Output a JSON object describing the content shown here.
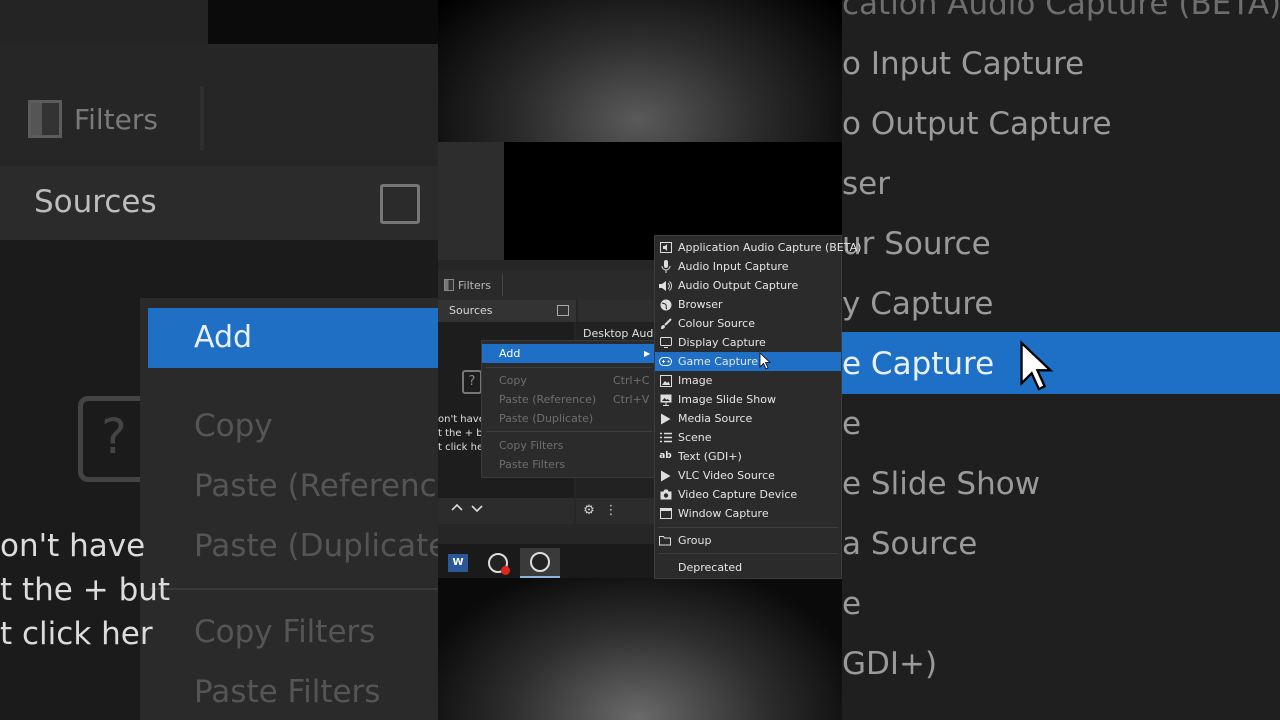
{
  "background_left": {
    "filters_label": "Filters",
    "sources_label": "Sources",
    "menu": {
      "add": "Add",
      "items": [
        "Copy",
        "Paste (Reference)",
        "Paste (Duplicate)",
        "Copy Filters",
        "Paste Filters"
      ]
    },
    "hint_lines": [
      "on't have",
      "t the + but",
      "t click her"
    ]
  },
  "background_right": {
    "items": [
      "cation Audio Capture (BETA)",
      "o Input Capture",
      "o Output Capture",
      "ser",
      "ur Source",
      "y Capture",
      "e Capture",
      "e",
      "e Slide Show",
      "a Source",
      "e",
      "GDI+)"
    ],
    "selected": "e Capture"
  },
  "obs": {
    "filters_label": "Filters",
    "sources_label": "Sources",
    "desktop_audio": "Desktop Audio",
    "hint_lines": [
      "on't have",
      "t the + but",
      "t click her"
    ],
    "word_icon": "W"
  },
  "context_menu": {
    "add": "Add",
    "copy": "Copy",
    "copy_shortcut": "Ctrl+C",
    "paste_reference": "Paste (Reference)",
    "paste_shortcut": "Ctrl+V",
    "paste_duplicate": "Paste (Duplicate)",
    "copy_filters": "Copy Filters",
    "paste_filters": "Paste Filters"
  },
  "add_submenu": {
    "items": [
      {
        "label": "Application Audio Capture (BETA)",
        "icon": "app-audio-icon"
      },
      {
        "label": "Audio Input Capture",
        "icon": "microphone-icon"
      },
      {
        "label": "Audio Output Capture",
        "icon": "speaker-icon"
      },
      {
        "label": "Browser",
        "icon": "globe-icon"
      },
      {
        "label": "Colour Source",
        "icon": "paint-brush-icon"
      },
      {
        "label": "Display Capture",
        "icon": "monitor-icon"
      },
      {
        "label": "Game Capture",
        "icon": "gamepad-icon"
      },
      {
        "label": "Image",
        "icon": "image-icon"
      },
      {
        "label": "Image Slide Show",
        "icon": "slideshow-icon"
      },
      {
        "label": "Media Source",
        "icon": "play-icon"
      },
      {
        "label": "Scene",
        "icon": "list-icon"
      },
      {
        "label": "Text (GDI+)",
        "icon": "text-icon"
      },
      {
        "label": "VLC Video Source",
        "icon": "play-icon"
      },
      {
        "label": "Video Capture Device",
        "icon": "camera-icon"
      },
      {
        "label": "Window Capture",
        "icon": "window-icon"
      }
    ],
    "group": "Group",
    "deprecated": "Deprecated",
    "selected": "Game Capture"
  },
  "colors": {
    "accent": "#1f6fc6",
    "menu_bg": "#2b2b2b",
    "disabled_text": "#6e6e6e"
  }
}
